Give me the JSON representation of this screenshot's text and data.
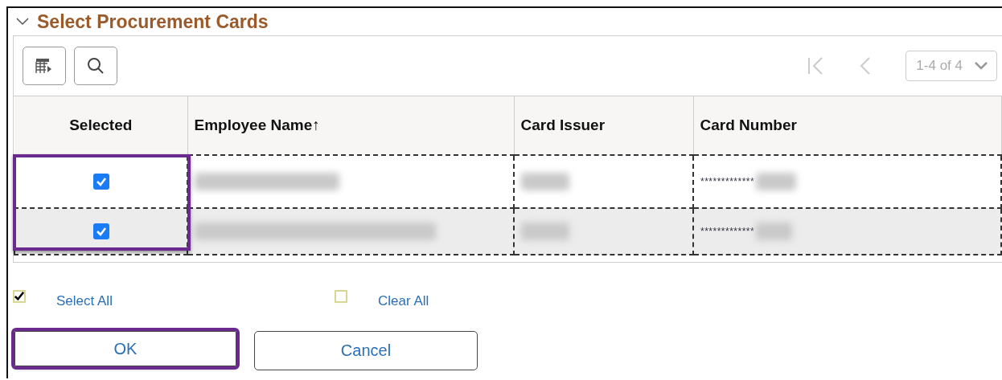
{
  "section": {
    "title": "Select Procurement Cards",
    "expanded": true
  },
  "pager": {
    "range": "1-4 of 4"
  },
  "table": {
    "columns": [
      {
        "label": "Selected"
      },
      {
        "label": "Employee Name↑"
      },
      {
        "label": "Card Issuer"
      },
      {
        "label": "Card Number"
      }
    ],
    "selected_column_highlighted": true,
    "rows": [
      {
        "checked": true,
        "card_number": "*************"
      },
      {
        "checked": true,
        "card_number": "*************"
      }
    ]
  },
  "links": [
    {
      "label": "Select All",
      "checked": true
    },
    {
      "label": "Clear All",
      "checked": false
    }
  ],
  "buttons": [
    {
      "label": "OK",
      "highlighted": true
    },
    {
      "label": "Cancel",
      "highlighted": false
    }
  ]
}
